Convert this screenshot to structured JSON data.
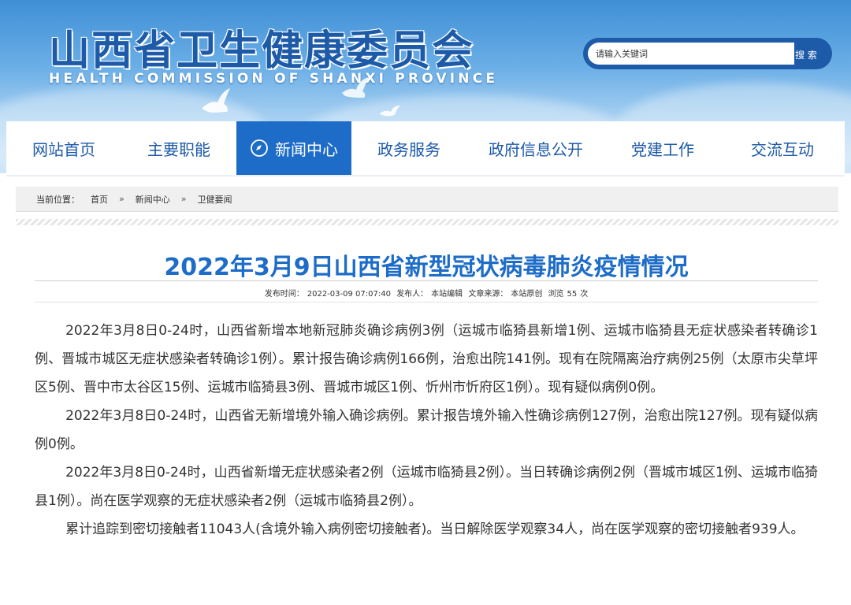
{
  "header": {
    "title_cn": "山西省卫生健康委员会",
    "title_en": "HEALTH COMMISSION OF SHANXI PROVINCE",
    "search_placeholder": "请输入关键词",
    "search_button": "搜 索"
  },
  "nav": {
    "items": [
      {
        "label": "网站首页",
        "active": false
      },
      {
        "label": "主要职能",
        "active": false
      },
      {
        "label": "新闻中心",
        "active": true
      },
      {
        "label": "政务服务",
        "active": false
      },
      {
        "label": "政府信息公开",
        "active": false
      },
      {
        "label": "党建工作",
        "active": false
      },
      {
        "label": "交流互动",
        "active": false
      }
    ]
  },
  "breadcrumb": {
    "prefix": "当前位置：",
    "items": [
      "首页",
      "新闻中心",
      "卫健要闻"
    ],
    "separator": "»"
  },
  "article": {
    "title": "2022年3月9日山西省新型冠状病毒肺炎疫情情况",
    "meta": {
      "publish_time_label": "发布时间：",
      "publish_time": "2022-03-09 07:07:40",
      "publisher_label": "发布人：",
      "publisher": "本站编辑",
      "source_label": "文章来源：",
      "source": "本站原创",
      "views_label": "浏览",
      "views": "55",
      "views_unit": "次"
    },
    "paragraphs": [
      "2022年3月8日0-24时，山西省新增本地新冠肺炎确诊病例3例（运城市临猗县新增1例、运城市临猗县无症状感染者转确诊1例、晋城市城区无症状感染者转确诊1例）。累计报告确诊病例166例，治愈出院141例。现有在院隔离治疗病例25例（太原市尖草坪区5例、晋中市太谷区15例、运城市临猗县3例、晋城市城区1例、忻州市忻府区1例）。现有疑似病例0例。",
      "2022年3月8日0-24时，山西省无新增境外输入确诊病例。累计报告境外输入性确诊病例127例，治愈出院127例。现有疑似病例0例。",
      "2022年3月8日0-24时，山西省新增无症状感染者2例（运城市临猗县2例）。当日转确诊病例2例（晋城市城区1例、运城市临猗县1例）。尚在医学观察的无症状感染者2例（运城市临猗县2例）。",
      "累计追踪到密切接触者11043人(含境外输入病例密切接触者)。当日解除医学观察34人，尚在医学观察的密切接触者939人。"
    ]
  },
  "colors": {
    "brand_blue": "#1d5aa8",
    "active_nav": "#1d6cc7",
    "title_blue": "#1d6cc7"
  },
  "icons": {
    "search": "search-icon",
    "nav_active": "globe-icon",
    "decor": "dove-icon"
  }
}
